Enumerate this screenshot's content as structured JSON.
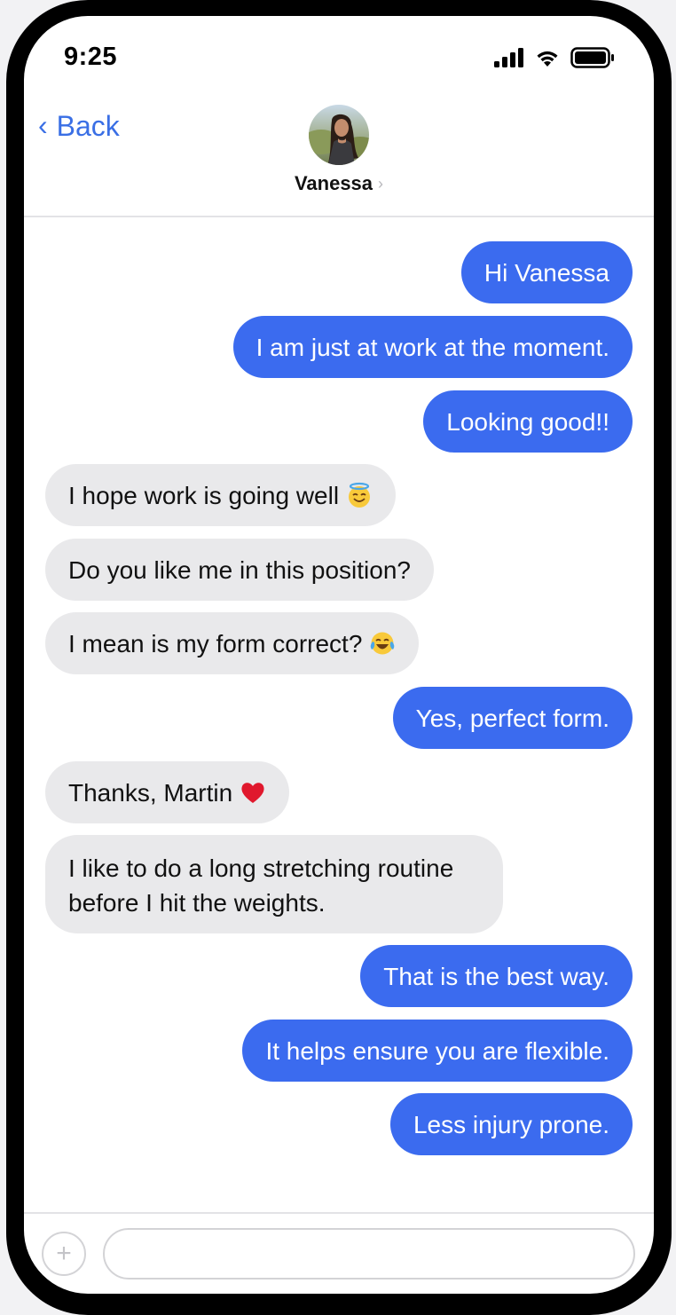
{
  "status_bar": {
    "time": "9:25",
    "signal_icon": "cellular-signal-icon",
    "wifi_icon": "wifi-icon",
    "battery_icon": "battery-icon"
  },
  "nav": {
    "back_label": "Back",
    "contact_name": "Vanessa",
    "avatar_icon": "contact-avatar"
  },
  "colors": {
    "accent": "#3a6fe5",
    "outgoing_bubble": "#3b6bef",
    "incoming_bubble": "#e9e9eb"
  },
  "messages": [
    {
      "direction": "outgoing",
      "text": "Hi Vanessa"
    },
    {
      "direction": "outgoing",
      "text": "I am just at work at the moment."
    },
    {
      "direction": "outgoing",
      "text": "Looking good!!"
    },
    {
      "direction": "incoming",
      "text": "I hope work is going well",
      "emoji": "smiling-face-with-halo-emoji"
    },
    {
      "direction": "incoming",
      "text": "Do you like me in this position?"
    },
    {
      "direction": "incoming",
      "text": "I mean is my form correct?",
      "emoji": "face-with-tears-of-joy-emoji"
    },
    {
      "direction": "outgoing",
      "text": "Yes, perfect form."
    },
    {
      "direction": "incoming",
      "text": "Thanks, Martin",
      "emoji": "red-heart-emoji"
    },
    {
      "direction": "incoming",
      "text": "I like to do a long stretching routine before I hit the weights."
    },
    {
      "direction": "outgoing",
      "text": "That is the best way."
    },
    {
      "direction": "outgoing",
      "text": "It helps ensure you are flexible."
    },
    {
      "direction": "outgoing",
      "text": "Less injury prone."
    }
  ],
  "input_bar": {
    "plus_icon": "plus-icon",
    "message_placeholder": ""
  }
}
